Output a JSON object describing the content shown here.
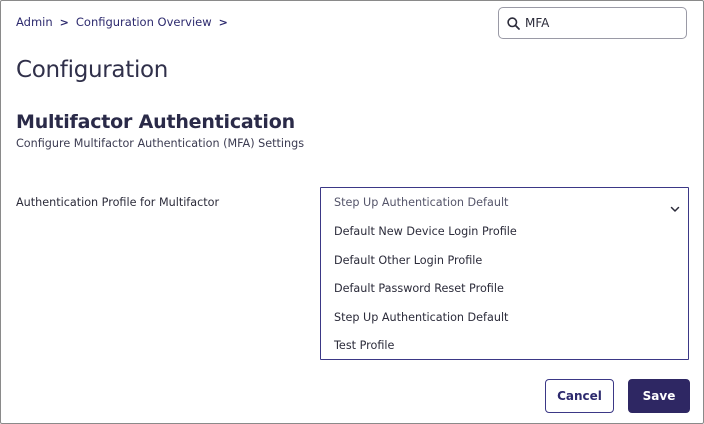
{
  "breadcrumb": {
    "items": [
      "Admin",
      "Configuration Overview"
    ],
    "separator": ">"
  },
  "search": {
    "value": "MFA",
    "icon": "search-icon"
  },
  "page": {
    "title": "Configuration"
  },
  "section": {
    "title": "Multifactor Authentication",
    "subtitle": "Configure Multifactor Authentication (MFA) Settings"
  },
  "field": {
    "label": "Authentication Profile for Multifactor",
    "selected": "Step Up Authentication Default",
    "options": [
      "Default New Device Login Profile",
      "Default Other Login Profile",
      "Default Password Reset Profile",
      "Step Up Authentication Default",
      "Test Profile"
    ]
  },
  "actions": {
    "cancel_label": "Cancel",
    "save_label": "Save"
  },
  "colors": {
    "accent": "#2e2763",
    "link": "#2d2a6e",
    "border": "#3b3886"
  }
}
